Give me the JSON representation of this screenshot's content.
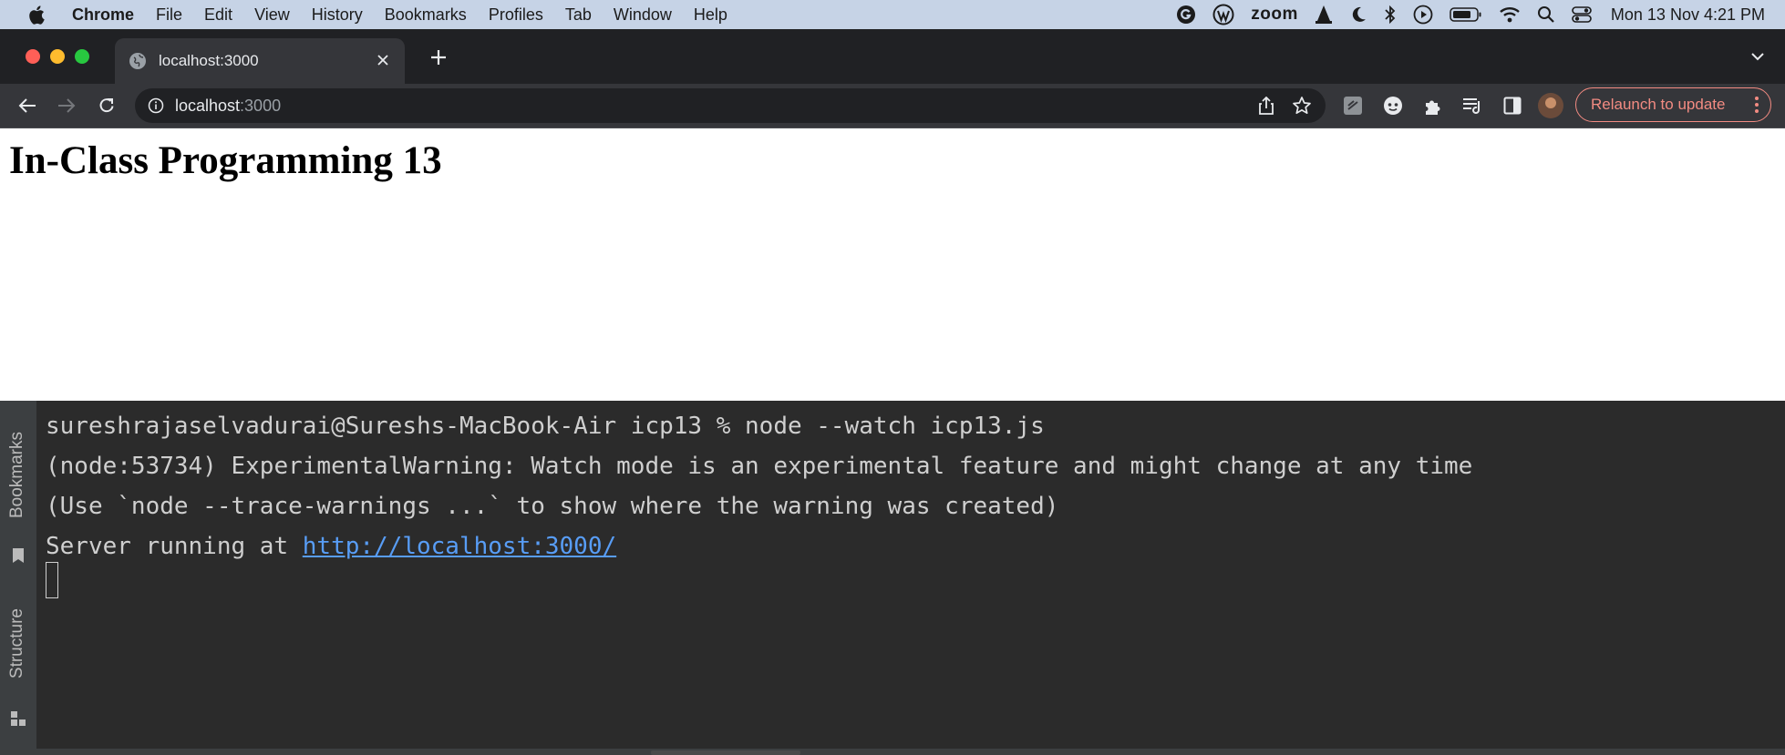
{
  "menubar": {
    "app_name": "Chrome",
    "items": [
      "File",
      "Edit",
      "View",
      "History",
      "Bookmarks",
      "Profiles",
      "Tab",
      "Window",
      "Help"
    ],
    "zoom_label": "zoom",
    "clock": "Mon 13 Nov  4:21 PM"
  },
  "browser": {
    "tab_title": "localhost:3000",
    "url_host": "localhost",
    "url_port": ":3000",
    "relaunch_label": "Relaunch to update",
    "accent_color": "#f28b82"
  },
  "page": {
    "heading": "In-Class Programming 13"
  },
  "ide": {
    "side_labels": [
      "Bookmarks",
      "Structure"
    ],
    "terminal_lines": [
      "sureshrajaselvadurai@Sureshs-MacBook-Air icp13 % node --watch icp13.js",
      "(node:53734) ExperimentalWarning: Watch mode is an experimental feature and might change at any time",
      "(Use `node --trace-warnings ...` to show where the warning was created)"
    ],
    "server_prefix": "Server running at ",
    "server_link": "http://localhost:3000/",
    "link_color": "#589df6"
  }
}
